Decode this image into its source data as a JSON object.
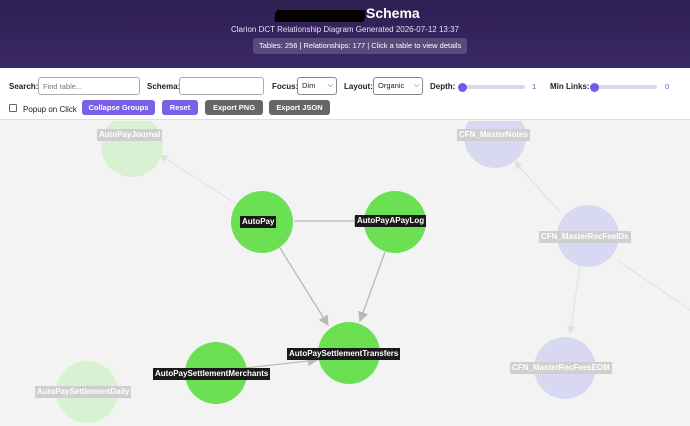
{
  "header": {
    "title": "Schema",
    "subtitle": "Clarion DCT Relationship Diagram Generated 2026-07-12 13:37",
    "stats": "Tables: 256 | Relationships: 177 | Click a table to view details"
  },
  "controls": {
    "search_label": "Search:",
    "search_placeholder": "Find table...",
    "schema_label": "Schema:",
    "schema_value": "",
    "focus_label": "Focus:",
    "focus_value": "Dim",
    "layout_label": "Layout:",
    "layout_value": "Organic",
    "depth_label": "Depth:",
    "depth_value": "1",
    "minlinks_label": "Min Links:",
    "minlinks_value": "0",
    "popup_label": "Popup on Click",
    "popup_checked": false,
    "collapse_button": "Collapse Groups",
    "reset_button": "Reset",
    "export_png_button": "Export PNG",
    "export_json_button": "Export JSON"
  },
  "graph": {
    "nodes": {
      "autopay": "AutoPay",
      "autopayapaylog": "AutoPayAPayLog",
      "transfers": "AutoPaySettlementTransfers",
      "merchants": "AutoPaySettlementMerchants",
      "journal": "AutoPayJournal",
      "daily": "AutoPaySettlementDaily",
      "masternotes": "CFN_MasterNotes",
      "recfeeids": "CFN_MasterRecFeeIDs",
      "recfeeseom": "CFN_MasterRecFeesEOM"
    },
    "colors": {
      "active": "#6ae052",
      "dim_green": "#d9f1d3",
      "dim_purple": "#d9d8f2",
      "edge": "#b8b8b8"
    }
  }
}
